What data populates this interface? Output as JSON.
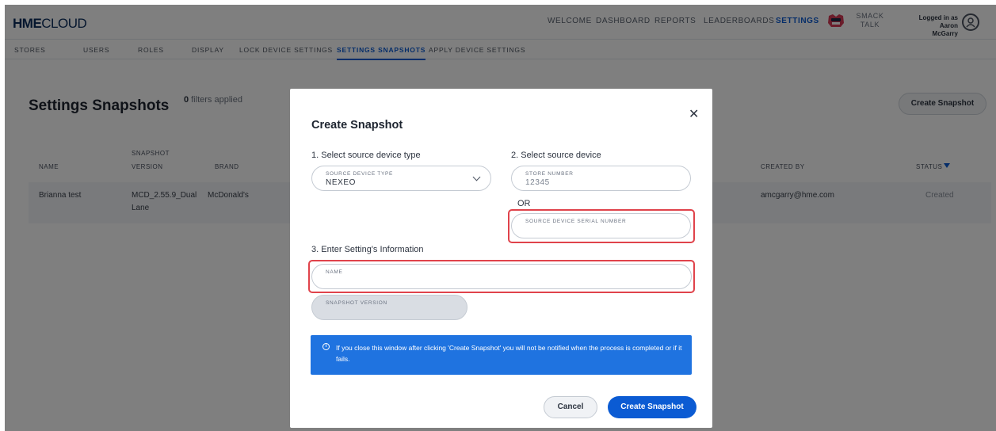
{
  "brand": {
    "bold": "HME",
    "light": "CLOUD"
  },
  "nav": {
    "welcome": "WELCOME",
    "dashboard": "DASHBOARD",
    "reports": "REPORTS",
    "leaderboards": "LEADERBOARDS",
    "settings": "SETTINGS",
    "smack_line1": "SMACK",
    "smack_line2": "TALK",
    "logged_in_line1": "Logged in as Aaron",
    "logged_in_line2": "McGarry"
  },
  "subnav": {
    "stores": "STORES",
    "users": "USERS",
    "roles": "ROLES",
    "display": "DISPLAY",
    "lock_device_settings": "LOCK DEVICE SETTINGS",
    "settings_snapshots": "SETTINGS SNAPSHOTS",
    "apply_device_settings": "APPLY DEVICE SETTINGS"
  },
  "page": {
    "title": "Settings Snapshots",
    "filters_count": "0",
    "filters_text": "filters applied",
    "create_button": "Create Snapshot"
  },
  "table": {
    "headers": {
      "name": "NAME",
      "snapshot_version_1": "SNAPSHOT",
      "snapshot_version_2": "VERSION",
      "brand": "BRAND",
      "created_by": "CREATED BY",
      "status": "STATUS"
    },
    "rows": [
      {
        "name": "Brianna test",
        "version_1": "MCD_2.55.9_Dual",
        "version_2": "Lane",
        "brand": "McDonald's",
        "created_by": "amcgarry@hme.com",
        "status": "Created"
      }
    ]
  },
  "modal": {
    "title": "Create Snapshot",
    "close": "✕",
    "step1": "1. Select source device type",
    "step2": "2. Select source device",
    "step3": "3. Enter Setting's Information",
    "device_type_label": "SOURCE DEVICE TYPE",
    "device_type_value": "NEXEO",
    "store_number_label": "STORE NUMBER",
    "store_number_value": "12345",
    "or": "OR",
    "serial_label": "SOURCE DEVICE SERIAL NUMBER",
    "name_label": "NAME",
    "snapshot_version_label": "SNAPSHOT VERSION",
    "info_text": "If you close this window after clicking 'Create Snapshot' you will not be notified when the process is completed or if it fails.",
    "cancel": "Cancel",
    "create": "Create Snapshot"
  },
  "colors": {
    "accent": "#0b5bd3",
    "highlight": "#e0434b",
    "info_bg": "#1f73e0"
  }
}
